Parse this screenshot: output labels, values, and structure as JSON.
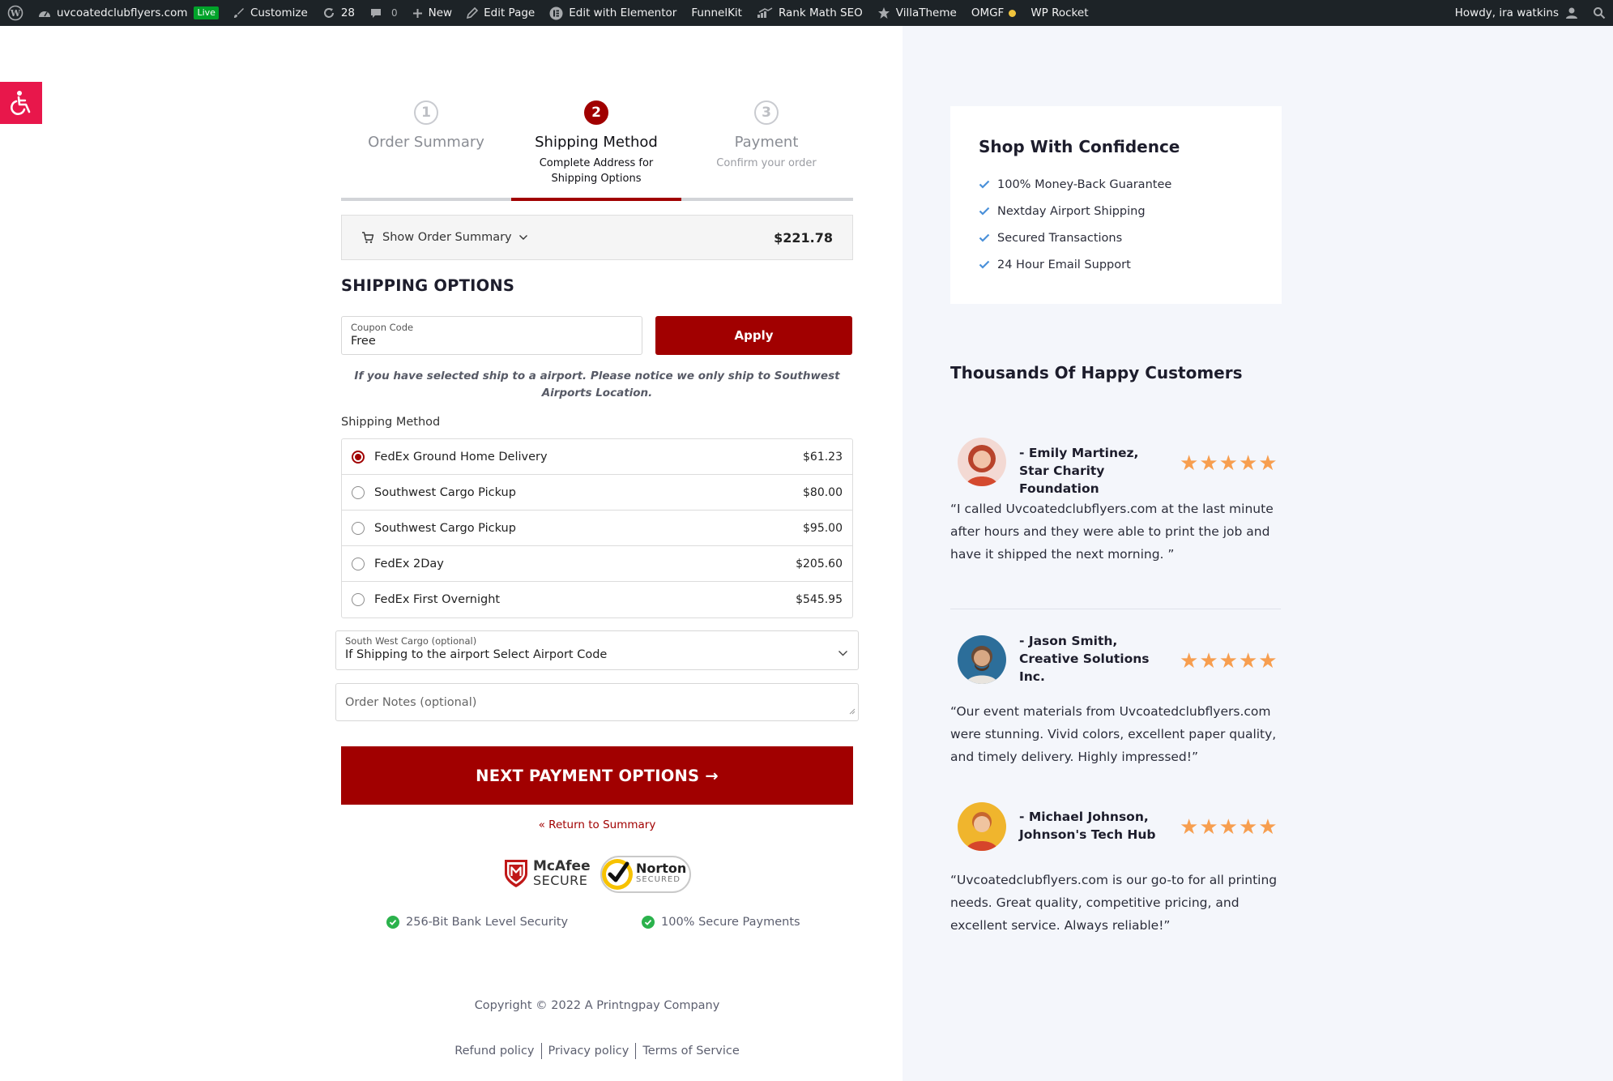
{
  "admin_bar": {
    "site_name": "uvcoatedclubflyers.com",
    "live_badge": "Live",
    "customize": "Customize",
    "updates_count": "28",
    "comments_count": "0",
    "new": "New",
    "edit_page": "Edit Page",
    "elementor": "Edit with Elementor",
    "funnelkit": "FunnelKit",
    "rank_math": "Rank Math SEO",
    "villatheme": "VillaTheme",
    "omgf": "OMGF",
    "wp_rocket": "WP Rocket",
    "howdy": "Howdy, ira watkins"
  },
  "steps": [
    {
      "number": "1",
      "title": "Order Summary",
      "subtitle": ""
    },
    {
      "number": "2",
      "title": "Shipping Method",
      "subtitle": "Complete Address for Shipping Options"
    },
    {
      "number": "3",
      "title": "Payment",
      "subtitle": "Confirm your order"
    }
  ],
  "order_summary": {
    "label": "Show Order Summary",
    "total": "$221.78"
  },
  "shipping_title": "SHIPPING OPTIONS",
  "coupon": {
    "label": "Coupon Code",
    "value": "Free",
    "apply_label": "Apply"
  },
  "notice": "If you have selected ship to a airport. Please notice we only ship to Southwest Airports Location.",
  "shipping_method_label": "Shipping Method",
  "shipping_options": [
    {
      "name": "FedEx Ground Home Delivery",
      "price": "$61.23",
      "selected": true
    },
    {
      "name": "Southwest Cargo Pickup",
      "price": "$80.00",
      "selected": false
    },
    {
      "name": "Southwest Cargo Pickup",
      "price": "$95.00",
      "selected": false
    },
    {
      "name": "FedEx 2Day",
      "price": "$205.60",
      "selected": false
    },
    {
      "name": "FedEx First Overnight",
      "price": "$545.95",
      "selected": false
    }
  ],
  "airport_select": {
    "label": "South West Cargo (optional)",
    "value": "If Shipping to the airport Select Airport Code"
  },
  "order_notes": {
    "placeholder": "Order Notes (optional)"
  },
  "next_button": "NEXT PAYMENT OPTIONS →",
  "return_link": "« Return to Summary",
  "badges": {
    "mcafee_name": "McAfee",
    "mcafee_secure": "SECURE",
    "norton_name": "Norton",
    "norton_secured": "SECURED"
  },
  "security": {
    "bank_level": "256-Bit Bank Level Security",
    "secure_payments": "100% Secure Payments"
  },
  "footer": {
    "copyright": "Copyright © 2022 A Printngpay Company",
    "links": [
      "Refund policy",
      "Privacy policy",
      "Terms of Service"
    ]
  },
  "confidence": {
    "title": "Shop With Confidence",
    "items": [
      "100% Money-Back Guarantee",
      "Nextday Airport Shipping",
      "Secured Transactions",
      "24 Hour Email Support"
    ]
  },
  "testimonials_title": "Thousands Of  Happy Customers",
  "testimonials": [
    {
      "name": "- Emily Martinez, Star Charity Foundation",
      "stars": 5,
      "quote": "“I called Uvcoatedclubflyers.com at the last minute after hours and they were able to print the job and have it shipped the next morning. ”"
    },
    {
      "name": "- Jason Smith, Creative Solutions Inc.",
      "stars": 5,
      "quote": "“Our event materials from Uvcoatedclubflyers.com were stunning. Vivid colors, excellent paper quality, and timely delivery. Highly impressed!”"
    },
    {
      "name": "- Michael Johnson, Johnson's Tech Hub",
      "stars": 5,
      "quote": "“Uvcoatedclubflyers.com is our go-to for all printing needs. Great quality, competitive pricing, and excellent service. Always reliable!”"
    }
  ],
  "colors": {
    "brand_red": "#a10000",
    "star_orange": "#f79e4f",
    "accessibility_pink": "#e8174b",
    "check_blue": "#4a90d9",
    "check_green": "#2bb24c"
  }
}
